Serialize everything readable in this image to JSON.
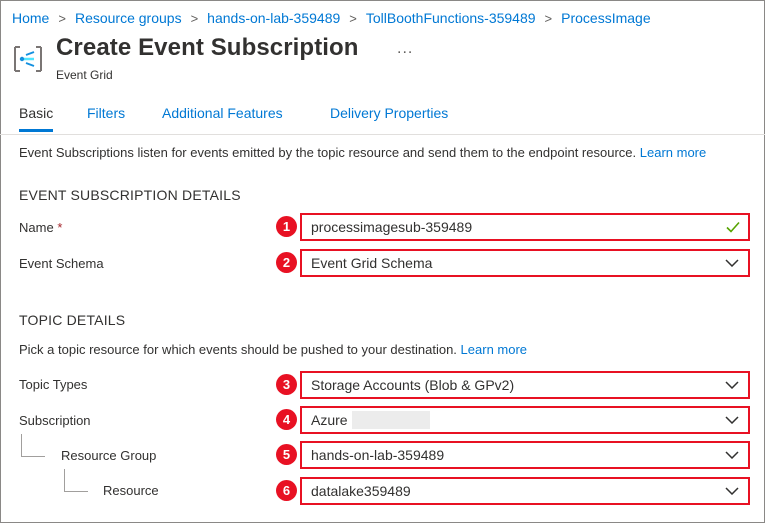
{
  "breadcrumb": {
    "items": [
      "Home",
      "Resource groups",
      "hands-on-lab-359489",
      "TollBoothFunctions-359489",
      "ProcessImage"
    ],
    "separator": ">"
  },
  "header": {
    "title": "Create Event Subscription",
    "more": "...",
    "subtitle": "Event Grid"
  },
  "tabs": [
    "Basic",
    "Filters",
    "Additional Features",
    "Delivery Properties"
  ],
  "info": {
    "text": "Event Subscriptions listen for events emitted by the topic resource and send them to the endpoint resource.",
    "link": "Learn more"
  },
  "event_subscription_details": {
    "heading": "EVENT SUBSCRIPTION DETAILS",
    "name_label": "Name",
    "required_mark": "*",
    "name_value": "processimagesub-359489",
    "schema_label": "Event Schema",
    "schema_value": "Event Grid Schema"
  },
  "topic_details": {
    "heading": "TOPIC DETAILS",
    "description": "Pick a topic resource for which events should be pushed to your destination.",
    "link": "Learn more",
    "topic_types_label": "Topic Types",
    "topic_types_value": "Storage Accounts (Blob & GPv2)",
    "subscription_label": "Subscription",
    "subscription_value": "Azure",
    "resource_group_label": "Resource Group",
    "resource_group_value": "hands-on-lab-359489",
    "resource_label": "Resource",
    "resource_value": "datalake359489"
  },
  "badges": [
    "1",
    "2",
    "3",
    "4",
    "5",
    "6"
  ],
  "colors": {
    "accent": "#0078d4",
    "highlight": "#e81123",
    "valid": "#57a300",
    "text": "#323130"
  },
  "icons": {
    "service": "event-grid-icon",
    "valid": "checkmark-icon",
    "dropdown": "chevron-down-icon",
    "more": "ellipsis-icon"
  }
}
